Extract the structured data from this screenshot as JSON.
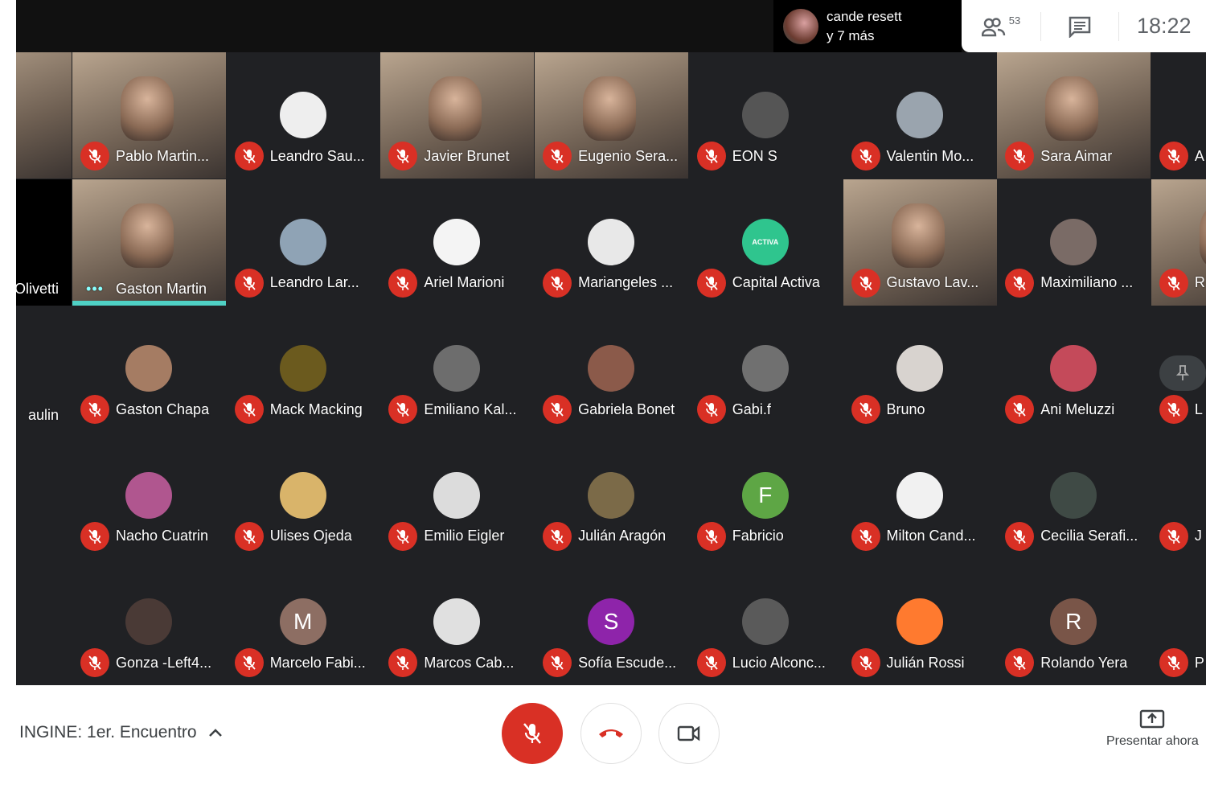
{
  "topbar": {
    "speaker_name": "cande resett",
    "speaker_more": "y 7 más",
    "participants_count": "53",
    "time": "18:22"
  },
  "colors": {
    "mute_red": "#d93025",
    "speaking": "#4fd1c5",
    "background": "#202124"
  },
  "left_column": [
    {
      "name": "",
      "type": "video"
    },
    {
      "name": "Olivetti",
      "type": "black"
    },
    {
      "name": "aulin",
      "type": "empty"
    },
    {
      "name": "",
      "type": "empty"
    },
    {
      "name": "",
      "type": "empty"
    }
  ],
  "rows": [
    [
      {
        "name": "Pablo Martin...",
        "type": "video"
      },
      {
        "name": "Leandro Sau...",
        "type": "avatar",
        "color": "#eeeeee"
      },
      {
        "name": "Javier Brunet",
        "type": "video"
      },
      {
        "name": "Eugenio Sera...",
        "type": "video"
      },
      {
        "name": "EON S",
        "type": "avatar",
        "color": "#555555"
      },
      {
        "name": "Valentin Mo...",
        "type": "avatar",
        "color": "#9aa4ae"
      },
      {
        "name": "Sara Aimar",
        "type": "video"
      },
      {
        "name": "A",
        "type": "empty"
      }
    ],
    [
      {
        "name": "Gaston Martin",
        "type": "video",
        "speaking": true
      },
      {
        "name": "Leandro Lar...",
        "type": "avatar",
        "color": "#8fa3b5"
      },
      {
        "name": "Ariel Marioni",
        "type": "avatar",
        "color": "#f4f4f4"
      },
      {
        "name": "Mariangeles ...",
        "type": "avatar",
        "color": "#e8e8e8"
      },
      {
        "name": "Capital Activa",
        "type": "avatar",
        "color": "#2fc58e",
        "letter": "ACTIVA"
      },
      {
        "name": "Gustavo Lav...",
        "type": "video"
      },
      {
        "name": "Maximiliano ...",
        "type": "avatar",
        "color": "#7a6b66"
      },
      {
        "name": "R",
        "type": "video"
      }
    ],
    [
      {
        "name": "Gaston Chapa",
        "type": "avatar",
        "color": "#a57c63"
      },
      {
        "name": "Mack Macking",
        "type": "avatar",
        "color": "#6b5a1e"
      },
      {
        "name": "Emiliano Kal...",
        "type": "avatar",
        "color": "#6d6d6d"
      },
      {
        "name": "Gabriela Bonet",
        "type": "avatar",
        "color": "#8b5a4a"
      },
      {
        "name": "Gabi.f",
        "type": "avatar",
        "color": "#707070"
      },
      {
        "name": "Bruno",
        "type": "avatar",
        "color": "#d8d3cf"
      },
      {
        "name": "Ani Meluzzi",
        "type": "avatar",
        "color": "#c44a5a"
      },
      {
        "name": "L",
        "type": "pinned"
      }
    ],
    [
      {
        "name": "Nacho Cuatrin",
        "type": "avatar",
        "color": "#b0568f"
      },
      {
        "name": "Ulises Ojeda",
        "type": "avatar",
        "color": "#d9b46a"
      },
      {
        "name": "Emilio Eigler",
        "type": "avatar",
        "color": "#dcdcdc"
      },
      {
        "name": "Julián Aragón",
        "type": "avatar",
        "color": "#7b6a48"
      },
      {
        "name": "Fabricio",
        "type": "avatar",
        "color": "#5ea645",
        "letter": "F"
      },
      {
        "name": "Milton Cand...",
        "type": "avatar",
        "color": "#f1f1f1"
      },
      {
        "name": "Cecilia Serafi...",
        "type": "avatar",
        "color": "#3f4a45"
      },
      {
        "name": "J",
        "type": "empty"
      }
    ],
    [
      {
        "name": "Gonza -Left4...",
        "type": "avatar",
        "color": "#4a3a36"
      },
      {
        "name": "Marcelo Fabi...",
        "type": "avatar",
        "color": "#8d6e63",
        "letter": "M"
      },
      {
        "name": "Marcos Cab...",
        "type": "avatar",
        "color": "#e0e0e0"
      },
      {
        "name": "Sofía Escude...",
        "type": "avatar",
        "color": "#8e24aa",
        "letter": "S"
      },
      {
        "name": "Lucio Alconc...",
        "type": "avatar",
        "color": "#5a5a5a"
      },
      {
        "name": "Julián Rossi",
        "type": "avatar",
        "color": "#ff7a2f"
      },
      {
        "name": "Rolando Yera",
        "type": "avatar",
        "color": "#795548",
        "letter": "R"
      },
      {
        "name": "P",
        "type": "empty"
      }
    ]
  ],
  "bottom": {
    "meeting_title": "INGINE: 1er. Encuentro",
    "present_label": "Presentar ahora"
  }
}
